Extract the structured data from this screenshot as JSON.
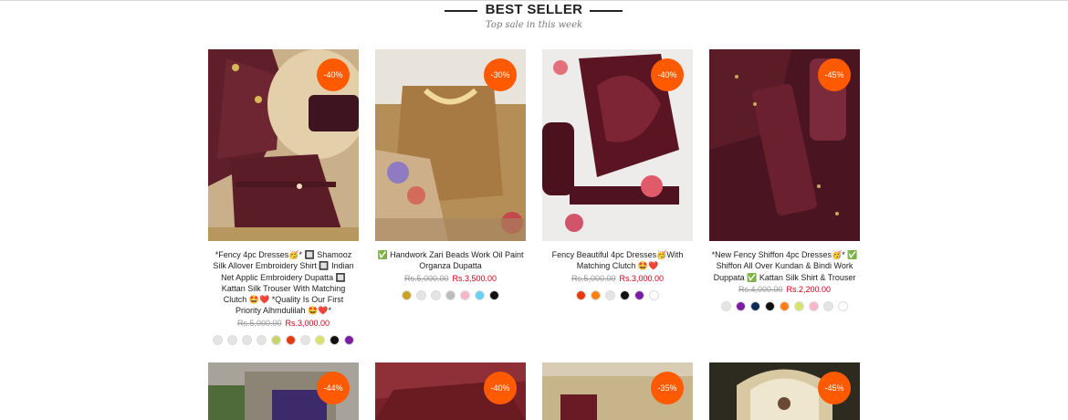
{
  "section": {
    "title": "BEST SELLER",
    "subtitle": "Top sale in this week"
  },
  "colors": {
    "accent": "#ff5a00",
    "sale_price": "#d0021b"
  },
  "products": [
    {
      "badge": "-40%",
      "name": "*Fency 4pc Dresses🥳* 🔲 Shamooz Silk Allover Embroidery Shirt 🔲 Indian Net Applic Embroidery Dupatta 🔲 Kattan Silk Trouser With Matching Clutch 🤩❤️ *Quality Is Our First Priority Alhmdulilah 🤩❤️*",
      "old_price": "Rs.5,000.00",
      "price": "Rs.3,000.00",
      "swatches": [
        "#e4e4e4",
        "#e4e4e4",
        "#e4e4e4",
        "#e4e4e4",
        "#c9d36a",
        "#e8380d",
        "#e4e4e4",
        "#d7e36a",
        "#111111",
        "#7a1fa2"
      ]
    },
    {
      "badge": "-30%",
      "name": "✅ Handwork Zari Beads Work Oil Paint Organza Dupatta",
      "old_price": "Rs.5,000.00",
      "price": "Rs.3,500.00",
      "swatches": [
        "#c9a227",
        "#e4e4e4",
        "#e4e4e4",
        "#bdbdbd",
        "#f7b6c9",
        "#6ad0f2",
        "#111111"
      ]
    },
    {
      "badge": "-40%",
      "name": "Fency Beautiful 4pc Dresses🥳With Matching Clutch 🤩❤️",
      "old_price": "Rs.5,000.00",
      "price": "Rs.3,000.00",
      "swatches": [
        "#e8380d",
        "#ff7f11",
        "#e4e4e4",
        "#111111",
        "#7a1fa2",
        "#ffffff"
      ]
    },
    {
      "badge": "-45%",
      "name": "*New Fency Shiffon 4pc Dresses🥳* ✅ Shiffon All Over Kundan & Bindi Work Duppata ✅ Kattan Silk Shirt & Trouser",
      "old_price": "Rs.4,000.00",
      "price": "Rs.2,200.00",
      "swatches": [
        "#e4e4e4",
        "#7a1fa2",
        "#0d2a57",
        "#111111",
        "#ff7f11",
        "#d7e36a",
        "#f7b6c9",
        "#e4e4e4",
        "#ffffff"
      ]
    },
    {
      "badge": "-44%"
    },
    {
      "badge": "-40%"
    },
    {
      "badge": "-35%"
    },
    {
      "badge": "-45%"
    }
  ]
}
